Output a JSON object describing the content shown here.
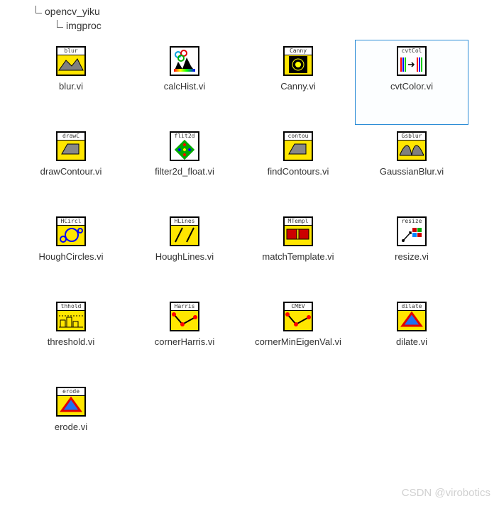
{
  "breadcrumbs": {
    "level1": "opencv_yiku",
    "level2": "imgproc"
  },
  "items": [
    {
      "name": "blur.vi",
      "title": "blur",
      "selected": false,
      "icon": "blur"
    },
    {
      "name": "calcHist.vi",
      "title": "",
      "selected": false,
      "icon": "calcHist"
    },
    {
      "name": "Canny.vi",
      "title": "Canny",
      "selected": false,
      "icon": "canny"
    },
    {
      "name": "cvtColor.vi",
      "title": "cvtCol",
      "selected": true,
      "icon": "cvtColor"
    },
    {
      "name": "drawContour.vi",
      "title": "drawC",
      "selected": false,
      "icon": "drawContour"
    },
    {
      "name": "filter2d_float.vi",
      "title": "flit2d",
      "selected": false,
      "icon": "filter2d"
    },
    {
      "name": "findContours.vi",
      "title": "contou",
      "selected": false,
      "icon": "findContours"
    },
    {
      "name": "GaussianBlur.vi",
      "title": "Gsblur",
      "selected": false,
      "icon": "gaussian"
    },
    {
      "name": "HoughCircles.vi",
      "title": "HCircl",
      "selected": false,
      "icon": "houghCircles"
    },
    {
      "name": "HoughLines.vi",
      "title": "HLines",
      "selected": false,
      "icon": "houghLines"
    },
    {
      "name": "matchTemplate.vi",
      "title": "MTempl",
      "selected": false,
      "icon": "matchTemplate"
    },
    {
      "name": "resize.vi",
      "title": "resize",
      "selected": false,
      "icon": "resize"
    },
    {
      "name": "threshold.vi",
      "title": "thhold",
      "selected": false,
      "icon": "threshold"
    },
    {
      "name": "cornerHarris.vi",
      "title": "Harris",
      "selected": false,
      "icon": "cornerHarris"
    },
    {
      "name": "cornerMinEigenVal.vi",
      "title": "CMEV",
      "selected": false,
      "icon": "cornerMEV"
    },
    {
      "name": "dilate.vi",
      "title": "dilate",
      "selected": false,
      "icon": "dilate"
    },
    {
      "name": "erode.vi",
      "title": "erode",
      "selected": false,
      "icon": "erode"
    }
  ],
  "watermark": "CSDN @virobotics"
}
